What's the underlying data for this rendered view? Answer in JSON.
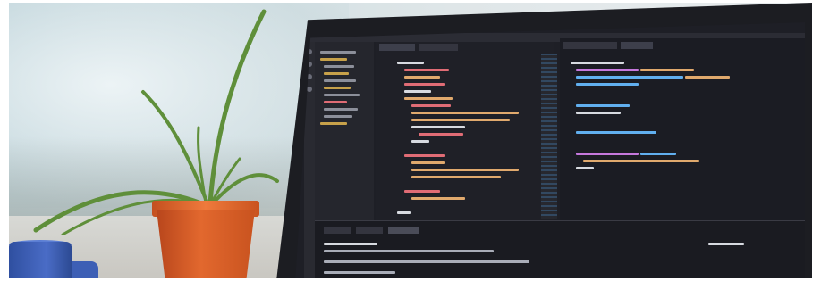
{
  "scene": {
    "palette": {
      "wall": "#d3e0e3",
      "pot": "#e2682e",
      "leaves": "#5f8f3a",
      "mug": "#4a6cc6",
      "laptop_bezel": "#1c1d22",
      "editor_background": "#1e1f26",
      "syntax_string": "#e0a96d",
      "syntax_keyword": "#c678dd",
      "syntax_function": "#61afef",
      "syntax_property": "#e06c75",
      "syntax_plain": "#d7dae0"
    },
    "icons": [
      "blurred-code-editor-screen",
      "potted-plant",
      "coffee-mug"
    ]
  }
}
